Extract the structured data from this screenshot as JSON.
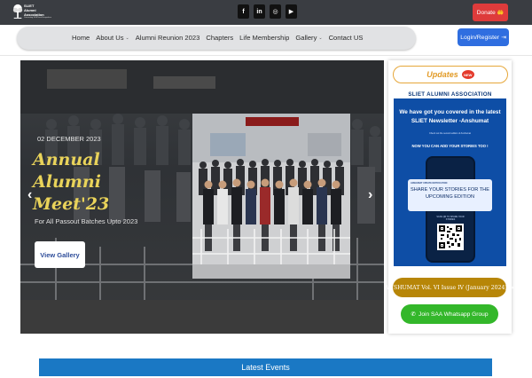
{
  "header": {
    "logo_lines": [
      "SLIET",
      "Alumni",
      "Association"
    ],
    "logo_tagline": "Connecting SLIETians Everywhere",
    "socials": [
      {
        "name": "facebook",
        "glyph": "f"
      },
      {
        "name": "linkedin",
        "glyph": "in"
      },
      {
        "name": "instagram",
        "glyph": "◎"
      },
      {
        "name": "youtube",
        "glyph": "▶"
      }
    ],
    "donate_label": "Donate",
    "donate_icon": "🤲"
  },
  "nav": {
    "items": [
      {
        "label": "Home",
        "dropdown": false
      },
      {
        "label": "About Us",
        "dropdown": true
      },
      {
        "label": "Alumni Reunion 2023",
        "dropdown": false
      },
      {
        "label": "Chapters",
        "dropdown": false
      },
      {
        "label": "Life Membership",
        "dropdown": false
      },
      {
        "label": "Gallery",
        "dropdown": true
      },
      {
        "label": "Contact US",
        "dropdown": false
      }
    ],
    "chevron": "⌄",
    "login_label": "Login/Register",
    "login_icon": "⇥"
  },
  "hero": {
    "date": "02 DECEMBER 2023",
    "title": "Annual Alumni Meet'23",
    "subtitle": "For All Passout Batches Upto 2023",
    "button_label": "View Gallery",
    "prev_arrow": "‹",
    "next_arrow": "›"
  },
  "updates": {
    "title": "Updates",
    "badge": "NEW",
    "poster": {
      "header": "SLIET ALUMNI ASSOCIATION",
      "headline": "We have got you covered in the latest SLIET Newsletter -Anshumat",
      "small": "Check out the second edition of Anshumat",
      "callout": "NOW YOU CAN ADD YOUR STORIES TOO !",
      "notif": "ANSHUMAT UPDATE NOTIFICATION",
      "share": "SHARE YOUR STORIES FOR THE UPCOMING EDITION",
      "scan": "SCAN QR TO SHARE YOUR STORIES"
    },
    "anshumat_label": "ANSHUMAT Vol. VI Issue IV (January 2024)",
    "anshumat_arrow": "➜",
    "whatsapp_label": "Join SAA Whatsapp Group",
    "whatsapp_icon": "✆"
  },
  "latest_events": {
    "title": "Latest Events"
  },
  "colors": {
    "topbar": "#3a3d42",
    "donate": "#de3b3b",
    "login": "#2f6ee0",
    "hero_title": "#e9d35a",
    "updates_accent": "#e29b27",
    "anshumat": "#b78608",
    "whatsapp": "#33b72a",
    "latest_events": "#1a78c4"
  }
}
